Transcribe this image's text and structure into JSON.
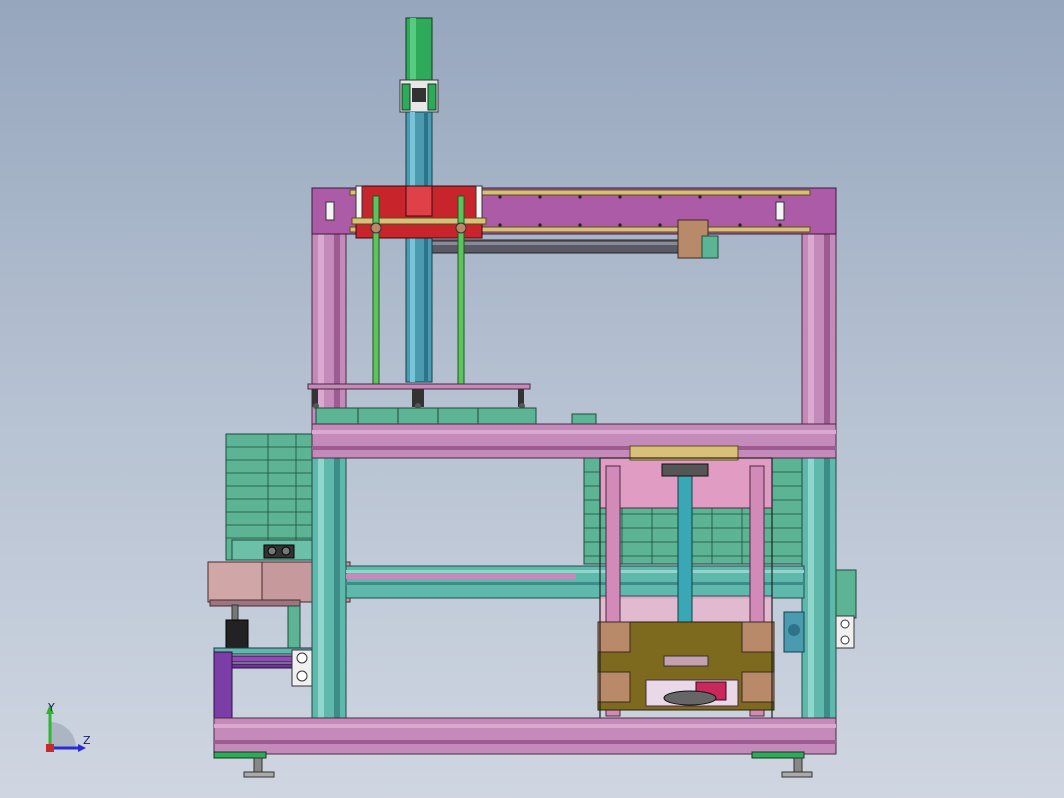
{
  "viewport": {
    "background_top": "#96a6bd",
    "background_bottom": "#cfd6e1"
  },
  "triad": {
    "x_label": "Y",
    "z_label": "Z",
    "y_color": "#2fb52f",
    "z_color": "#2a2ad6"
  },
  "colors": {
    "frame_pink": "#c48ab9",
    "frame_teal": "#5fb8ac",
    "rail_magenta": "#ac5ca6",
    "motor_green": "#2eaa5a",
    "column_teal": "#4a9ab0",
    "gripper_red": "#c8242c",
    "stack_green": "#5cb495",
    "tray_olive": "#7e6a1e",
    "lift_pink": "#e09cc3",
    "housing_brown": "#b98a6a",
    "panel_purple": "#7a3ea6"
  }
}
